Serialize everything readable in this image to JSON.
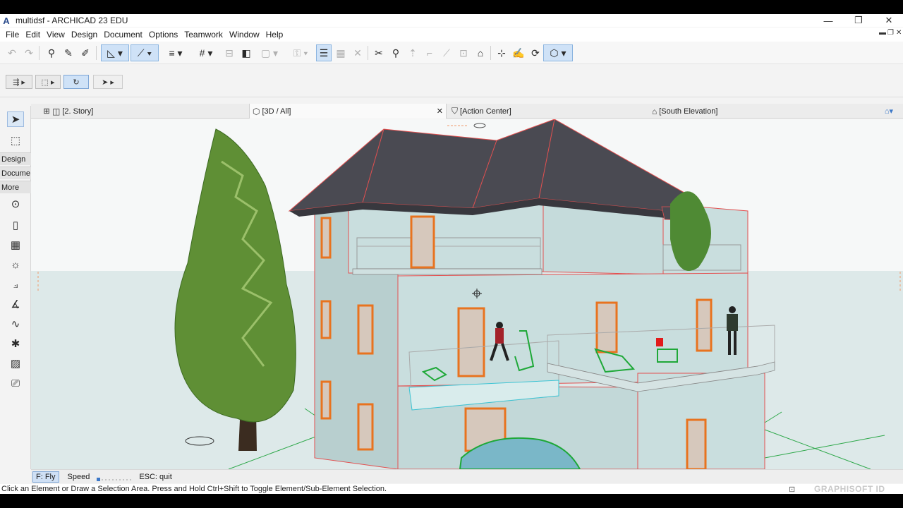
{
  "window": {
    "title": "multidsf - ARCHICAD 23 EDU",
    "minimize_icon": "minimize-icon",
    "restore_icon": "restore-icon",
    "close_icon": "close-icon"
  },
  "menubar": {
    "items": [
      "File",
      "Edit",
      "View",
      "Design",
      "Document",
      "Options",
      "Teamwork",
      "Window",
      "Help"
    ]
  },
  "toolbox": {
    "sections": [
      "Design",
      "Docume",
      "More"
    ]
  },
  "tabs": [
    {
      "label": "[2. Story]",
      "icon": "floor-plan-icon"
    },
    {
      "label": "[3D / All]",
      "icon": "3d-view-icon",
      "close": "✕"
    },
    {
      "label": "[Action Center]",
      "icon": "action-center-icon"
    },
    {
      "label": "[South Elevation]",
      "icon": "elevation-icon"
    }
  ],
  "flybar": {
    "mode": "F: Fly",
    "speed_label": "Speed",
    "hint": "ESC: quit"
  },
  "status": {
    "message": "Click an Element or Draw a Selection Area. Press and Hold Ctrl+Shift to Toggle Element/Sub-Element Selection.",
    "brand": "GRAPHISOFT ID"
  },
  "colors": {
    "wall": "#c9dede",
    "roof": "#4a4a52",
    "frame": "#e8731f",
    "tree": "#5f8f35",
    "selection_edge": "#e35050",
    "accent": "#cfe2f7"
  }
}
